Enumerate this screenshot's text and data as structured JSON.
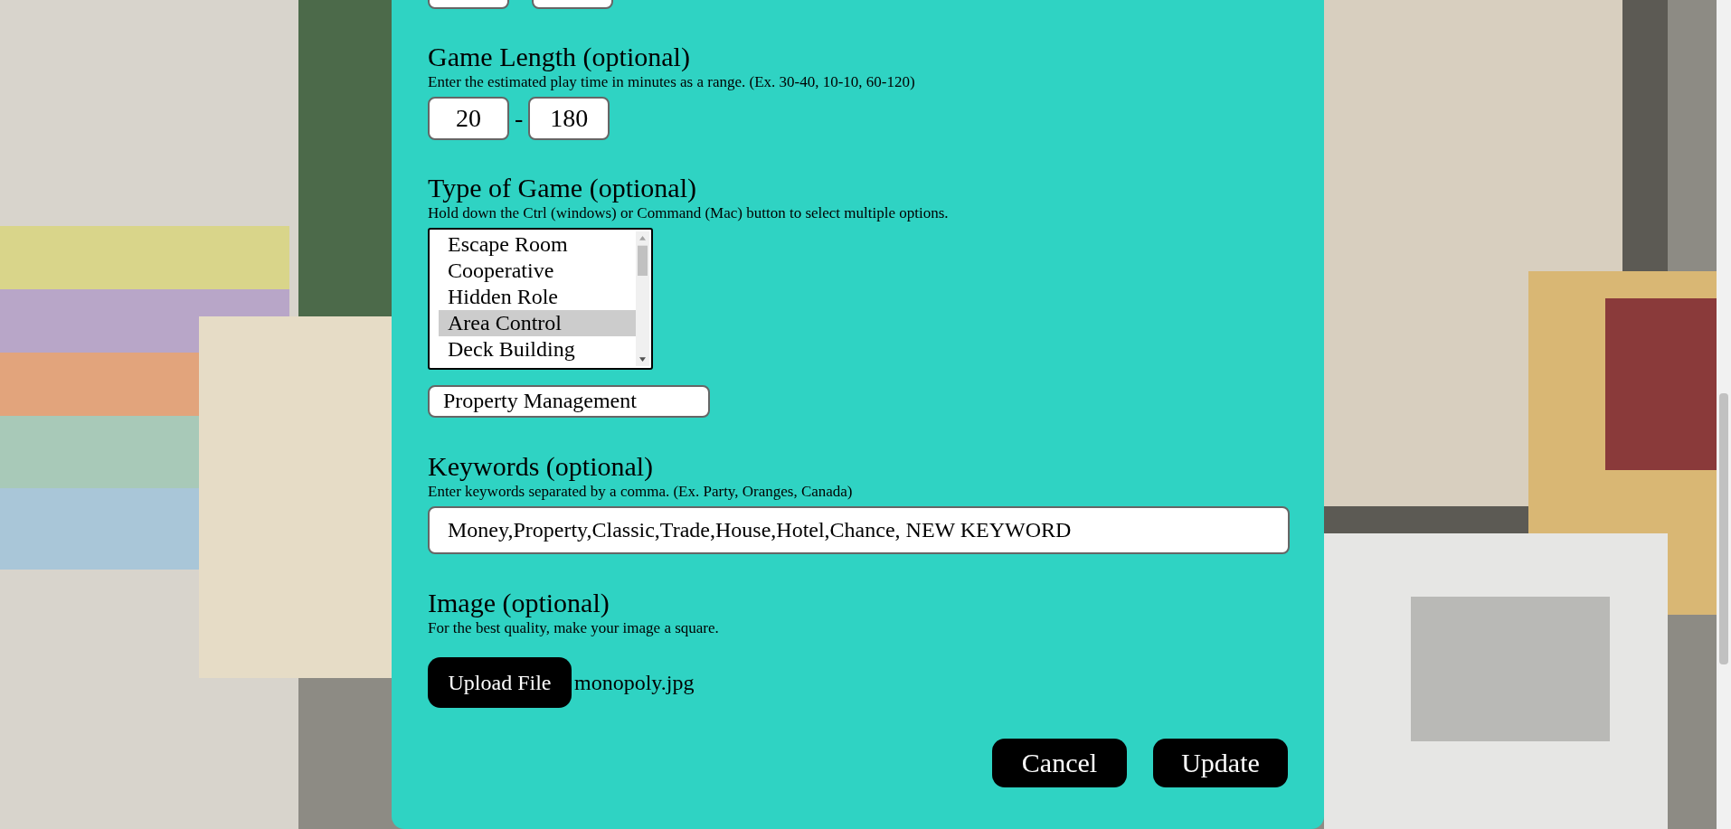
{
  "sections": [
    {
      "kind": "range",
      "title": "Game Length (optional)",
      "hint": "Enter the estimated play time in minutes as a range. (Ex. 30-40, 10-10, 60-120)",
      "from": "20",
      "separator": "-",
      "to": "180"
    },
    {
      "kind": "multiselect",
      "title": "Type of Game (optional)",
      "hint": "Hold down the Ctrl (windows) or Command (Mac) button to select multiple options.",
      "options": [
        {
          "label": "Escape Room",
          "selected": false
        },
        {
          "label": "Cooperative",
          "selected": false
        },
        {
          "label": "Hidden Role",
          "selected": false
        },
        {
          "label": "Area Control",
          "selected": true
        },
        {
          "label": "Deck Building",
          "selected": false
        }
      ],
      "other_value": "Property Management"
    },
    {
      "kind": "text",
      "title": "Keywords (optional)",
      "hint": "Enter keywords separated by a comma. (Ex. Party, Oranges, Canada)",
      "value": "Money,Property,Classic,Trade,House,Hotel,Chance, NEW KEYWORD"
    },
    {
      "kind": "file",
      "title": "Image (optional)",
      "hint": "For the best quality, make your image a square.",
      "button": "Upload File",
      "file_name": "monopoly.jpg"
    }
  ],
  "buttons": [
    "Cancel",
    "Update"
  ]
}
